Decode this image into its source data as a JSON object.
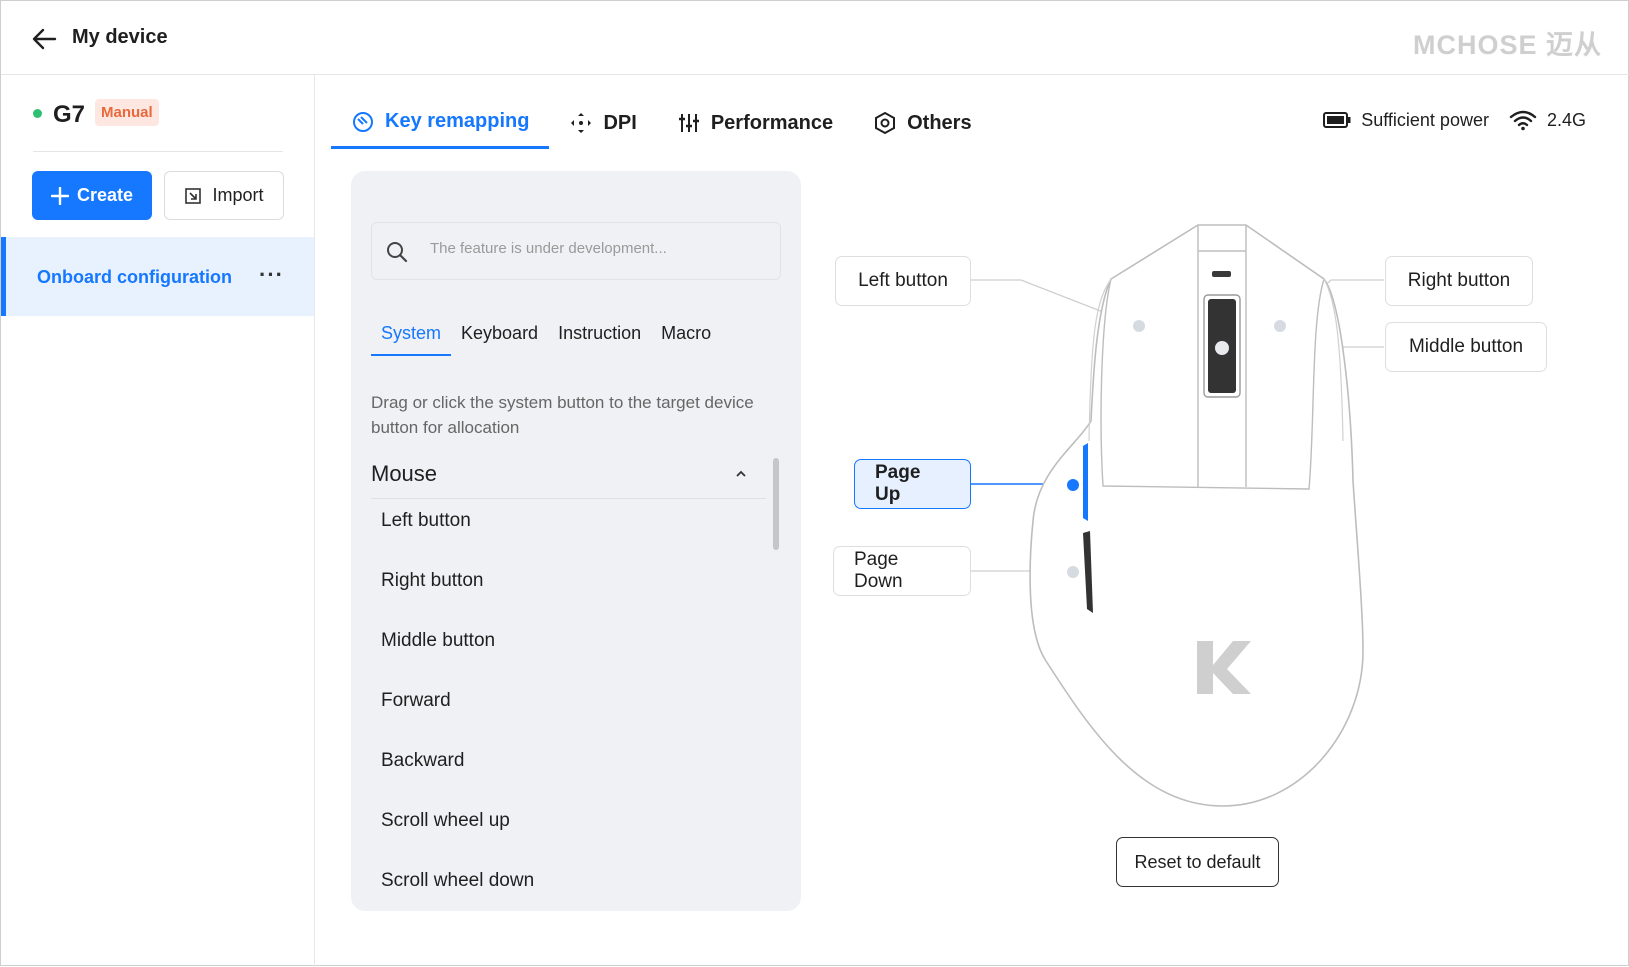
{
  "header": {
    "title": "My device",
    "brand": "MCHOSE 迈从"
  },
  "sidebar": {
    "device_name": "G7",
    "mode_badge": "Manual",
    "create_label": "Create",
    "import_label": "Import",
    "config_label": "Onboard configuration",
    "more_label": "···"
  },
  "tabs": [
    {
      "label": "Key remapping",
      "icon": "key-remap-icon",
      "active": true
    },
    {
      "label": "DPI",
      "icon": "dpi-icon",
      "active": false
    },
    {
      "label": "Performance",
      "icon": "sliders-icon",
      "active": false
    },
    {
      "label": "Others",
      "icon": "hex-gear-icon",
      "active": false
    }
  ],
  "status": {
    "power": "Sufficient power",
    "connection": "2.4G"
  },
  "panel": {
    "search_placeholder": "The feature is under development...",
    "sub_tabs": [
      "System",
      "Keyboard",
      "Instruction",
      "Macro"
    ],
    "active_sub_tab": "System",
    "hint": "Drag or click the system button to the target device button for allocation",
    "group_title": "Mouse",
    "actions": [
      "Left button",
      "Right button",
      "Middle button",
      "Forward",
      "Backward",
      "Scroll wheel up",
      "Scroll wheel down"
    ]
  },
  "diagram": {
    "callouts": {
      "left": "Left button",
      "right": "Right button",
      "middle": "Middle button",
      "side_front": "Page Up",
      "side_back": "Page Down"
    },
    "active_callout": "Page Up",
    "reset_label": "Reset to default"
  },
  "colors": {
    "accent": "#1677ff",
    "badge_bg": "#fde7e0",
    "badge_text": "#e86a3c",
    "online": "#2fbf71"
  }
}
